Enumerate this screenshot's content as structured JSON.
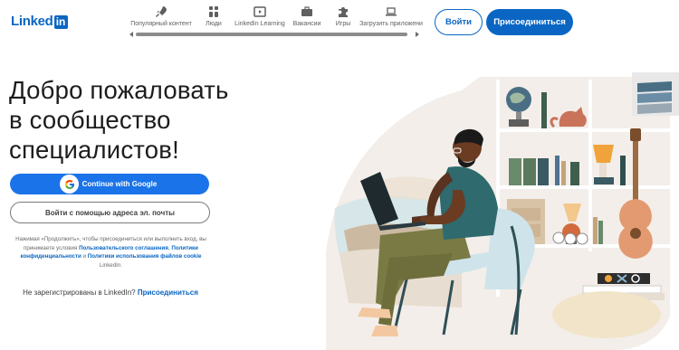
{
  "header": {
    "logo_text": "Linked",
    "logo_in": "in",
    "nav": [
      {
        "label": "Популярный контент",
        "icon": "rocket-icon"
      },
      {
        "label": "Люди",
        "icon": "people-icon"
      },
      {
        "label": "LinkedIn Learning",
        "icon": "video-icon"
      },
      {
        "label": "Вакансии",
        "icon": "briefcase-icon"
      },
      {
        "label": "Игры",
        "icon": "puzzle-icon"
      },
      {
        "label": "Загрузить приложени",
        "icon": "laptop-icon"
      }
    ],
    "signin_label": "Войти",
    "join_label": "Присоединиться"
  },
  "hero": {
    "title_line1": "Добро пожаловать",
    "title_line2": "в сообщество",
    "title_line3": "специалистов!",
    "google_label": "Continue with Google",
    "email_label": "Войти с помощью адреса эл. почты",
    "legal": {
      "prefix": "Нажимая «Продолжить», чтобы присоединиться или выполнить вход, вы принимаете условия ",
      "agreement_link": "Пользовательского соглашения",
      "comma": ", ",
      "privacy_link": "Политики конфиденциальности",
      "and": " и ",
      "cookie_link": "Политики использования файлов cookie",
      "suffix": " LinkedIn."
    },
    "signup_text": "Не зарегистрированы в LinkedIn? ",
    "signup_link": "Присоединиться"
  },
  "colors": {
    "brand_blue": "#0a66c2",
    "google_blue": "#1a73e8"
  }
}
